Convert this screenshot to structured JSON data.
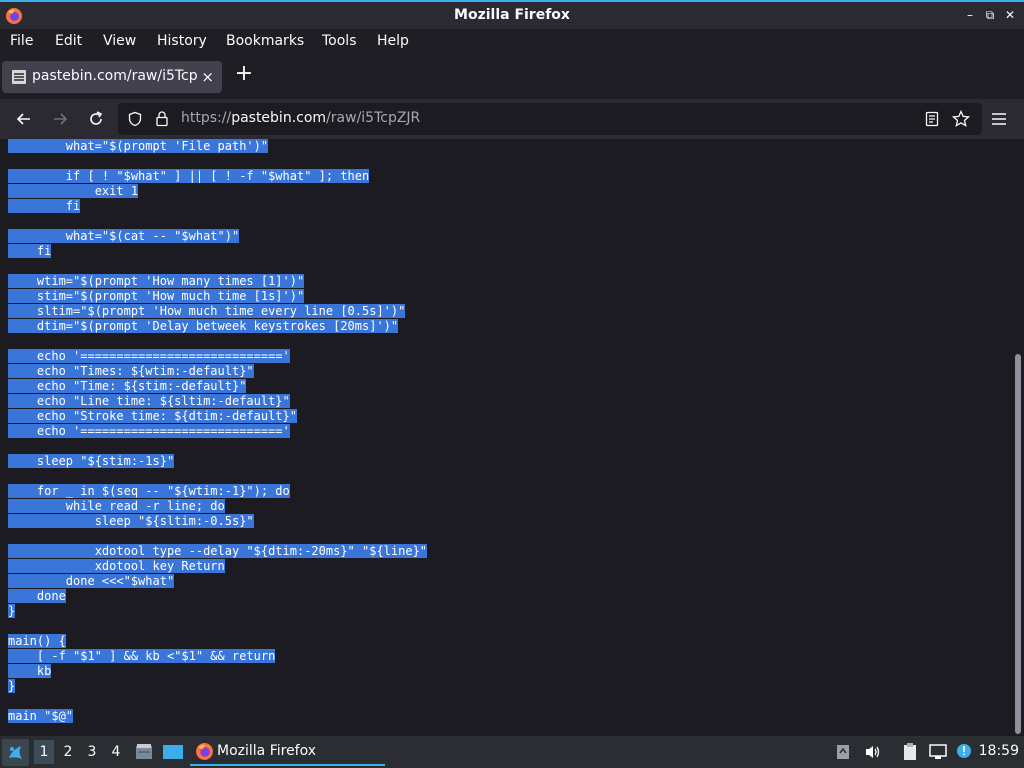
{
  "window": {
    "title": "Mozilla Firefox",
    "minimize_glyph": "–",
    "restore_glyph": "⧉",
    "close_glyph": "✕"
  },
  "menu": [
    "File",
    "Edit",
    "View",
    "History",
    "Bookmarks",
    "Tools",
    "Help"
  ],
  "tab": {
    "title": "pastebin.com/raw/i5TcpZJR",
    "close": "×",
    "new_tab": "+"
  },
  "navbar": {
    "url_scheme": "https://",
    "url_host": "pastebin.com",
    "url_path": "/raw/i5TcpZJR"
  },
  "code_lines": [
    "        what=\"$(prompt 'File path')\"",
    "",
    "        if [ ! \"$what\" ] || [ ! -f \"$what\" ]; then",
    "            exit 1",
    "        fi",
    "",
    "        what=\"$(cat -- \"$what\")\"",
    "    fi",
    "",
    "    wtim=\"$(prompt 'How many times [1]')\"",
    "    stim=\"$(prompt 'How much time [1s]')\"",
    "    sltim=\"$(prompt 'How much time every line [0.5s]')\"",
    "    dtim=\"$(prompt 'Delay betweek keystrokes [20ms]')\"",
    "",
    "    echo '============================'",
    "    echo \"Times: ${wtim:-default}\"",
    "    echo \"Time: ${stim:-default}\"",
    "    echo \"Line time: ${sltim:-default}\"",
    "    echo \"Stroke time: ${dtim:-default}\"",
    "    echo '============================'",
    "",
    "    sleep \"${stim:-1s}\"",
    "",
    "    for _ in $(seq -- \"${wtim:-1}\"); do",
    "        while read -r line; do",
    "            sleep \"${sltim:-0.5s}\"",
    "",
    "            xdotool type --delay \"${dtim:-20ms}\" \"${line}\"",
    "            xdotool key Return",
    "        done <<<\"$what\"",
    "    done",
    "}",
    "",
    "main() {",
    "    [ -f \"$1\" ] && kb <\"$1\" && return",
    "    kb",
    "}",
    "",
    "main \"$@\""
  ],
  "taskbar": {
    "desktops": [
      "1",
      "2",
      "3",
      "4"
    ],
    "app_label": "Mozilla Firefox",
    "clock": "18:59"
  },
  "colors": {
    "selection": "#3a75d9",
    "accent": "#3daee9",
    "page_bg": "#1c1b22"
  }
}
